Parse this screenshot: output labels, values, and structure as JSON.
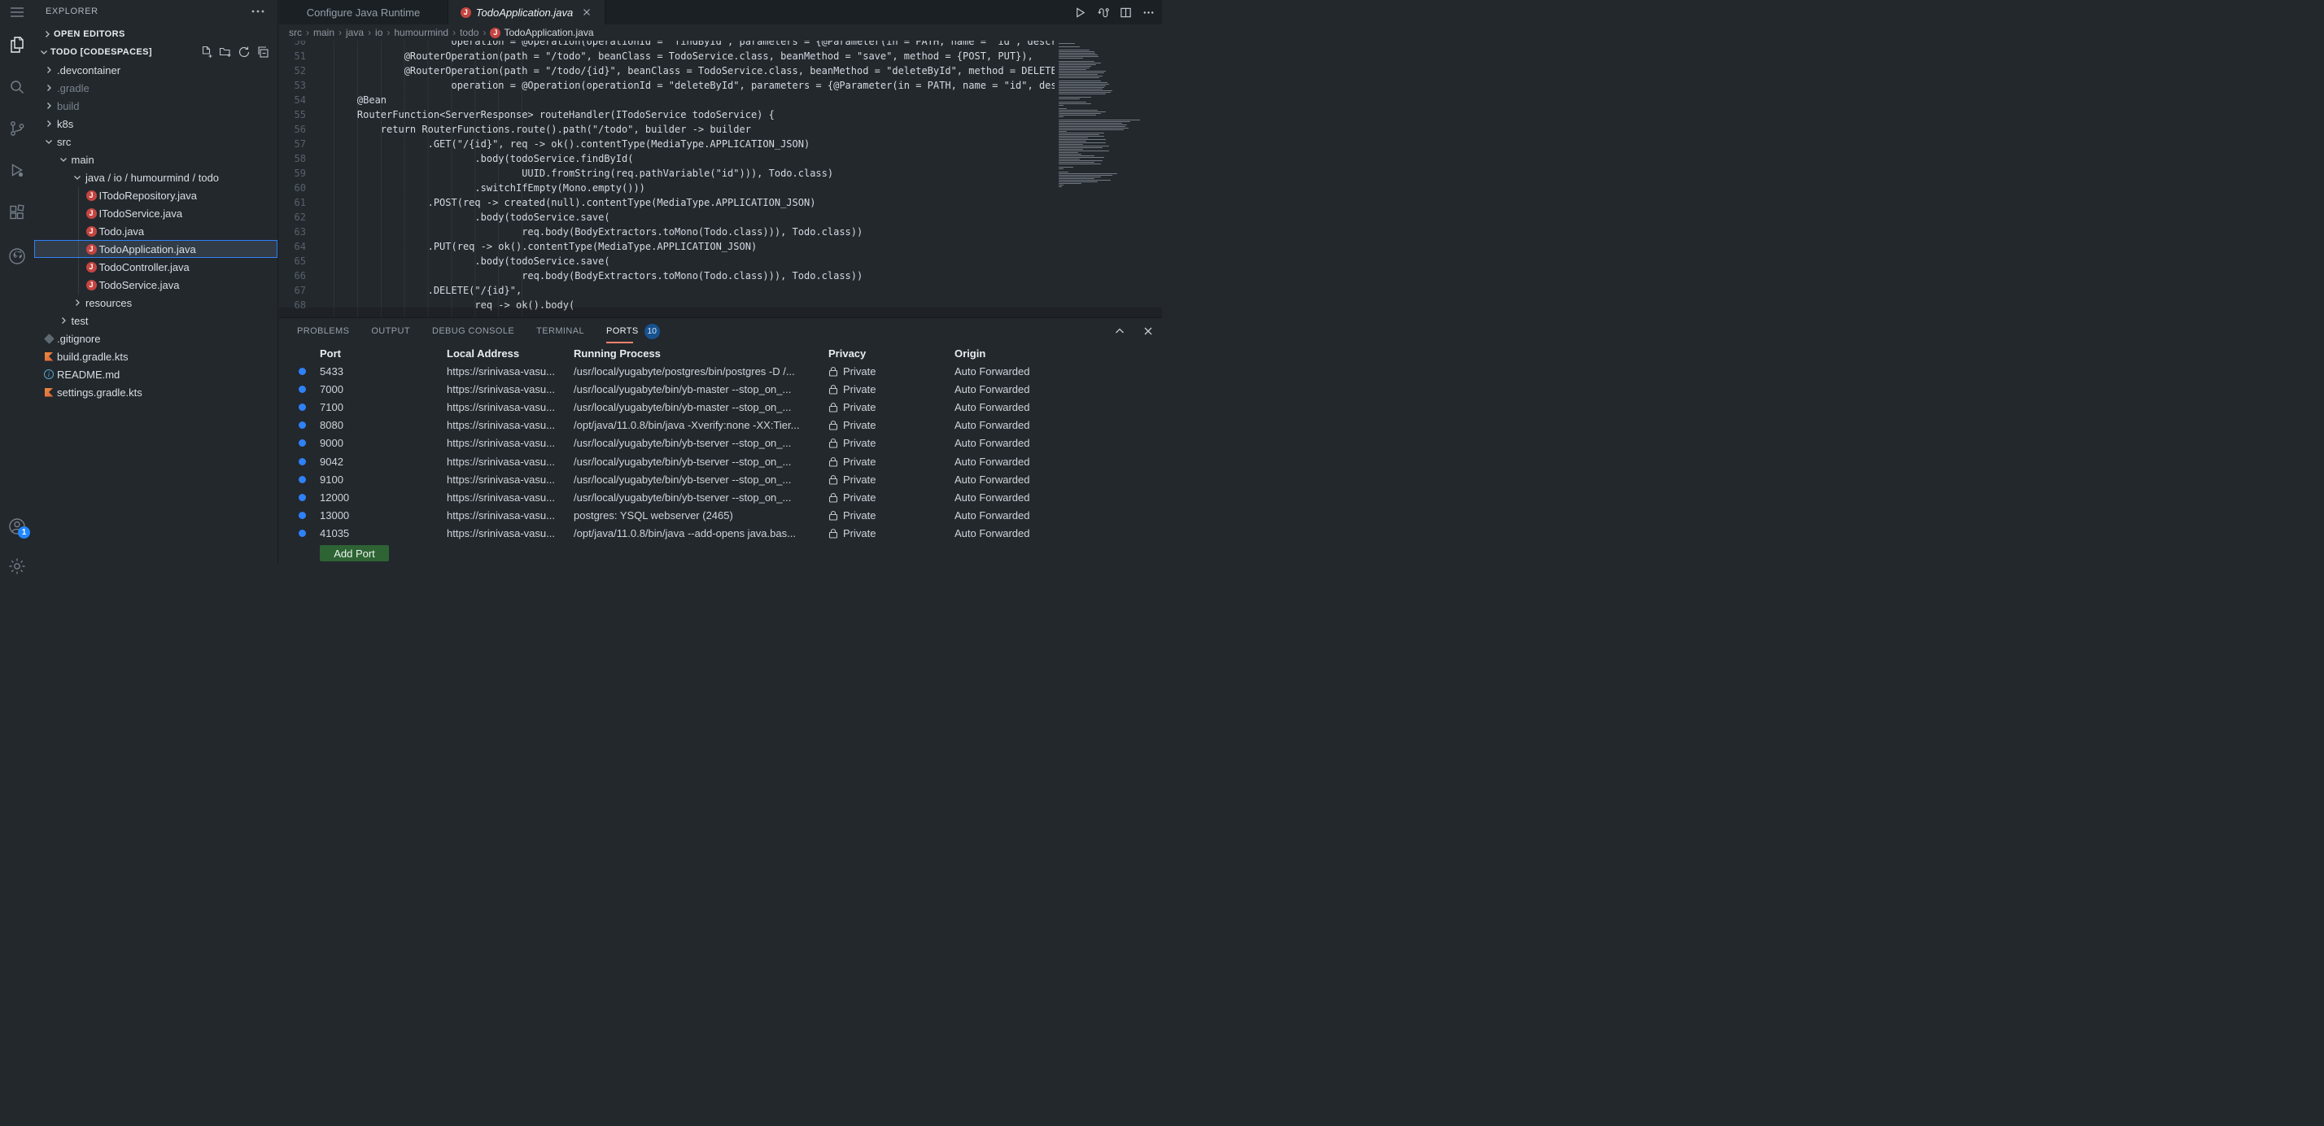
{
  "activity_bar": {
    "account_badge": "1",
    "icons": [
      "menu-icon",
      "explorer-icon",
      "search-icon",
      "source-control-icon",
      "run-debug-icon",
      "extensions-icon",
      "github-icon",
      "account-icon",
      "gear-icon"
    ]
  },
  "sidebar": {
    "title": "EXPLORER",
    "open_editors_label": "OPEN EDITORS",
    "project_label": "TODO [CODESPACES]",
    "project_actions": [
      "new-file-icon",
      "new-folder-icon",
      "refresh-icon",
      "collapse-all-icon"
    ],
    "tree": [
      {
        "label": ".devcontainer",
        "type": "folder",
        "depth": 0,
        "expanded": false
      },
      {
        "label": ".gradle",
        "type": "folder",
        "depth": 0,
        "expanded": false,
        "dimmed": true
      },
      {
        "label": "build",
        "type": "folder",
        "depth": 0,
        "expanded": false,
        "dimmed": true
      },
      {
        "label": "k8s",
        "type": "folder",
        "depth": 0,
        "expanded": false
      },
      {
        "label": "src",
        "type": "folder",
        "depth": 0,
        "expanded": true
      },
      {
        "label": "main",
        "type": "folder",
        "depth": 1,
        "expanded": true
      },
      {
        "label": "java / io / humourmind / todo",
        "type": "folder",
        "depth": 2,
        "expanded": true
      },
      {
        "label": "ITodoRepository.java",
        "type": "java",
        "depth": 3
      },
      {
        "label": "ITodoService.java",
        "type": "java",
        "depth": 3
      },
      {
        "label": "Todo.java",
        "type": "java",
        "depth": 3
      },
      {
        "label": "TodoApplication.java",
        "type": "java",
        "depth": 3,
        "selected": true
      },
      {
        "label": "TodoController.java",
        "type": "java",
        "depth": 3
      },
      {
        "label": "TodoService.java",
        "type": "java",
        "depth": 3
      },
      {
        "label": "resources",
        "type": "folder",
        "depth": 2,
        "expanded": false
      },
      {
        "label": "test",
        "type": "folder",
        "depth": 1,
        "expanded": false
      },
      {
        "label": ".gitignore",
        "type": "git",
        "depth": 0
      },
      {
        "label": "build.gradle.kts",
        "type": "kotlin",
        "depth": 0
      },
      {
        "label": "README.md",
        "type": "info",
        "depth": 0
      },
      {
        "label": "settings.gradle.kts",
        "type": "kotlin",
        "depth": 0
      }
    ]
  },
  "editor": {
    "tabs": [
      {
        "label": "Configure Java Runtime",
        "active": false,
        "icon": null
      },
      {
        "label": "TodoApplication.java",
        "active": true,
        "icon": "java",
        "closable": true
      }
    ],
    "breadcrumbs": [
      "src",
      "main",
      "java",
      "io",
      "humourmind",
      "todo",
      "TodoApplication.java"
    ],
    "code_lines": [
      {
        "n": 50,
        "t": "                    operation = @Operation(operationId = \"findById\", parameters = {@Parameter(in = PATH, name = \"id\", description = \"\")})),"
      },
      {
        "n": 51,
        "t": "            @RouterOperation(path = \"/todo\", beanClass = TodoService.class, beanMethod = \"save\", method = {POST, PUT}),"
      },
      {
        "n": 52,
        "t": "            @RouterOperation(path = \"/todo/{id}\", beanClass = TodoService.class, beanMethod = \"deleteById\", method = DELETE,"
      },
      {
        "n": 53,
        "t": "                    operation = @Operation(operationId = \"deleteById\", parameters = {@Parameter(in = PATH, name = \"id\", description = \"\")}))})"
      },
      {
        "n": 54,
        "t": "    @Bean"
      },
      {
        "n": 55,
        "t": "    RouterFunction<ServerResponse> routeHandler(ITodoService todoService) {"
      },
      {
        "n": 56,
        "t": "        return RouterFunctions.route().path(\"/todo\", builder -> builder"
      },
      {
        "n": 57,
        "t": "                .GET(\"/{id}\", req -> ok().contentType(MediaType.APPLICATION_JSON)"
      },
      {
        "n": 58,
        "t": "                        .body(todoService.findById("
      },
      {
        "n": 59,
        "t": "                                UUID.fromString(req.pathVariable(\"id\"))), Todo.class)"
      },
      {
        "n": 60,
        "t": "                        .switchIfEmpty(Mono.empty()))"
      },
      {
        "n": 61,
        "t": "                .POST(req -> created(null).contentType(MediaType.APPLICATION_JSON)"
      },
      {
        "n": 62,
        "t": "                        .body(todoService.save("
      },
      {
        "n": 63,
        "t": "                                req.body(BodyExtractors.toMono(Todo.class))), Todo.class))"
      },
      {
        "n": 64,
        "t": "                .PUT(req -> ok().contentType(MediaType.APPLICATION_JSON)"
      },
      {
        "n": 65,
        "t": "                        .body(todoService.save("
      },
      {
        "n": 66,
        "t": "                                req.body(BodyExtractors.toMono(Todo.class))), Todo.class))"
      },
      {
        "n": 67,
        "t": "                .DELETE(\"/{id}\","
      },
      {
        "n": 68,
        "t": "                        req -> ok().body("
      }
    ]
  },
  "panel": {
    "tabs": [
      {
        "label": "PROBLEMS",
        "active": false
      },
      {
        "label": "OUTPUT",
        "active": false
      },
      {
        "label": "DEBUG CONSOLE",
        "active": false
      },
      {
        "label": "TERMINAL",
        "active": false
      },
      {
        "label": "PORTS",
        "active": true,
        "badge": "10"
      }
    ],
    "ports": {
      "headers": [
        "Port",
        "Local Address",
        "Running Process",
        "Privacy",
        "Origin"
      ],
      "rows": [
        {
          "port": "5433",
          "address": "https://srinivasa-vasu...",
          "process": "/usr/local/yugabyte/postgres/bin/postgres -D /...",
          "privacy": "Private",
          "origin": "Auto Forwarded"
        },
        {
          "port": "7000",
          "address": "https://srinivasa-vasu...",
          "process": "/usr/local/yugabyte/bin/yb-master --stop_on_...",
          "privacy": "Private",
          "origin": "Auto Forwarded"
        },
        {
          "port": "7100",
          "address": "https://srinivasa-vasu...",
          "process": "/usr/local/yugabyte/bin/yb-master --stop_on_...",
          "privacy": "Private",
          "origin": "Auto Forwarded"
        },
        {
          "port": "8080",
          "address": "https://srinivasa-vasu...",
          "process": "/opt/java/11.0.8/bin/java -Xverify:none -XX:Tier...",
          "privacy": "Private",
          "origin": "Auto Forwarded"
        },
        {
          "port": "9000",
          "address": "https://srinivasa-vasu...",
          "process": "/usr/local/yugabyte/bin/yb-tserver --stop_on_...",
          "privacy": "Private",
          "origin": "Auto Forwarded"
        },
        {
          "port": "9042",
          "address": "https://srinivasa-vasu...",
          "process": "/usr/local/yugabyte/bin/yb-tserver --stop_on_...",
          "privacy": "Private",
          "origin": "Auto Forwarded"
        },
        {
          "port": "9100",
          "address": "https://srinivasa-vasu...",
          "process": "/usr/local/yugabyte/bin/yb-tserver --stop_on_...",
          "privacy": "Private",
          "origin": "Auto Forwarded"
        },
        {
          "port": "12000",
          "address": "https://srinivasa-vasu...",
          "process": "/usr/local/yugabyte/bin/yb-tserver --stop_on_...",
          "privacy": "Private",
          "origin": "Auto Forwarded"
        },
        {
          "port": "13000",
          "address": "https://srinivasa-vasu...",
          "process": "postgres: YSQL webserver (2465)",
          "privacy": "Private",
          "origin": "Auto Forwarded"
        },
        {
          "port": "41035",
          "address": "https://srinivasa-vasu...",
          "process": "/opt/java/11.0.8/bin/java --add-opens java.bas...",
          "privacy": "Private",
          "origin": "Auto Forwarded"
        }
      ],
      "add_button_label": "Add Port"
    }
  },
  "colors": {
    "accent_blue": "#2f81f7",
    "ports_tab_underline": "#f9826c",
    "ports_badge_bg": "#17528f",
    "add_port_green": "#2e6334",
    "java_icon_red": "#c54540",
    "kotlin_icon_orange": "#e8883a",
    "selection_border": "#2f81f7"
  }
}
